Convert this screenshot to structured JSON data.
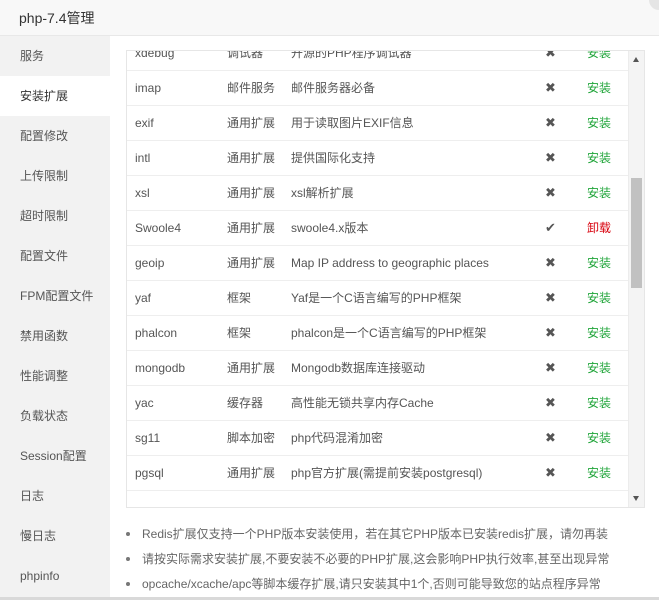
{
  "window": {
    "title": "php-7.4管理"
  },
  "sidebar": {
    "items": [
      {
        "label": "服务",
        "active": false
      },
      {
        "label": "安装扩展",
        "active": true
      },
      {
        "label": "配置修改",
        "active": false
      },
      {
        "label": "上传限制",
        "active": false
      },
      {
        "label": "超时限制",
        "active": false
      },
      {
        "label": "配置文件",
        "active": false
      },
      {
        "label": "FPM配置文件",
        "active": false
      },
      {
        "label": "禁用函数",
        "active": false
      },
      {
        "label": "性能调整",
        "active": false
      },
      {
        "label": "负载状态",
        "active": false
      },
      {
        "label": "Session配置",
        "active": false
      },
      {
        "label": "日志",
        "active": false
      },
      {
        "label": "慢日志",
        "active": false
      },
      {
        "label": "phpinfo",
        "active": false
      }
    ]
  },
  "extensions": {
    "rows": [
      {
        "name": "xdebug",
        "type": "调试器",
        "desc": "开源的PHP程序调试器",
        "status": "✖",
        "action": "安装",
        "action_kind": "install"
      },
      {
        "name": "imap",
        "type": "邮件服务",
        "desc": "邮件服务器必备",
        "status": "✖",
        "action": "安装",
        "action_kind": "install"
      },
      {
        "name": "exif",
        "type": "通用扩展",
        "desc": "用于读取图片EXIF信息",
        "status": "✖",
        "action": "安装",
        "action_kind": "install"
      },
      {
        "name": "intl",
        "type": "通用扩展",
        "desc": "提供国际化支持",
        "status": "✖",
        "action": "安装",
        "action_kind": "install"
      },
      {
        "name": "xsl",
        "type": "通用扩展",
        "desc": "xsl解析扩展",
        "status": "✖",
        "action": "安装",
        "action_kind": "install"
      },
      {
        "name": "Swoole4",
        "type": "通用扩展",
        "desc": "swoole4.x版本",
        "status": "✔",
        "action": "卸载",
        "action_kind": "uninstall"
      },
      {
        "name": "geoip",
        "type": "通用扩展",
        "desc": "Map IP address to geographic places",
        "status": "✖",
        "action": "安装",
        "action_kind": "install"
      },
      {
        "name": "yaf",
        "type": "框架",
        "desc": "Yaf是一个C语言编写的PHP框架",
        "status": "✖",
        "action": "安装",
        "action_kind": "install"
      },
      {
        "name": "phalcon",
        "type": "框架",
        "desc": "phalcon是一个C语言编写的PHP框架",
        "status": "✖",
        "action": "安装",
        "action_kind": "install"
      },
      {
        "name": "mongodb",
        "type": "通用扩展",
        "desc": "Mongodb数据库连接驱动",
        "status": "✖",
        "action": "安装",
        "action_kind": "install"
      },
      {
        "name": "yac",
        "type": "缓存器",
        "desc": "高性能无锁共享内存Cache",
        "status": "✖",
        "action": "安装",
        "action_kind": "install"
      },
      {
        "name": "sg11",
        "type": "脚本加密",
        "desc": "php代码混淆加密",
        "status": "✖",
        "action": "安装",
        "action_kind": "install"
      },
      {
        "name": "pgsql",
        "type": "通用扩展",
        "desc": "php官方扩展(需提前安装postgresql)",
        "status": "✖",
        "action": "安装",
        "action_kind": "install"
      }
    ]
  },
  "notes": [
    "Redis扩展仅支持一个PHP版本安装使用，若在其它PHP版本已安装redis扩展，请勿再装",
    "请按实际需求安装扩展,不要安装不必要的PHP扩展,这会影响PHP执行效率,甚至出现异常",
    "opcache/xcache/apc等脚本缓存扩展,请只安装其中1个,否则可能导致您的站点程序异常"
  ],
  "colors": {
    "install": "#20a53a",
    "uninstall": "#d8000c"
  },
  "icons": {
    "installed": "check-icon",
    "not_installed": "cross-icon"
  }
}
